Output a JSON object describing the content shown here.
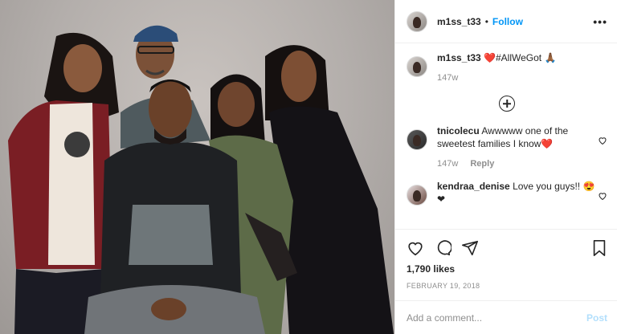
{
  "header": {
    "username": "m1ss_t33",
    "separator": "•",
    "follow_label": "Follow",
    "more_label": "•••"
  },
  "caption": {
    "username": "m1ss_t33",
    "text": "❤️#AllWeGot 🙏🏾",
    "age": "147w"
  },
  "comments": [
    {
      "username": "tnicolecu",
      "text": "Awwwww one of the sweetest families I know❤️",
      "age": "147w",
      "reply_label": "Reply"
    },
    {
      "username": "kendraa_denise",
      "text": "Love you guys!! 😍❤",
      "age": "",
      "reply_label": ""
    }
  ],
  "stats": {
    "likes": "1,790 likes",
    "date": "February 19, 2018"
  },
  "add_comment": {
    "placeholder": "Add a comment...",
    "post_label": "Post"
  },
  "icons": {
    "like": "heart-icon",
    "comment": "comment-icon",
    "share": "share-icon",
    "save": "bookmark-icon",
    "load_more": "plus-circle-icon"
  },
  "colors": {
    "link": "#0095f6",
    "post_disabled": "#b2dffc",
    "muted": "#8e8e8e",
    "text": "#262626"
  }
}
